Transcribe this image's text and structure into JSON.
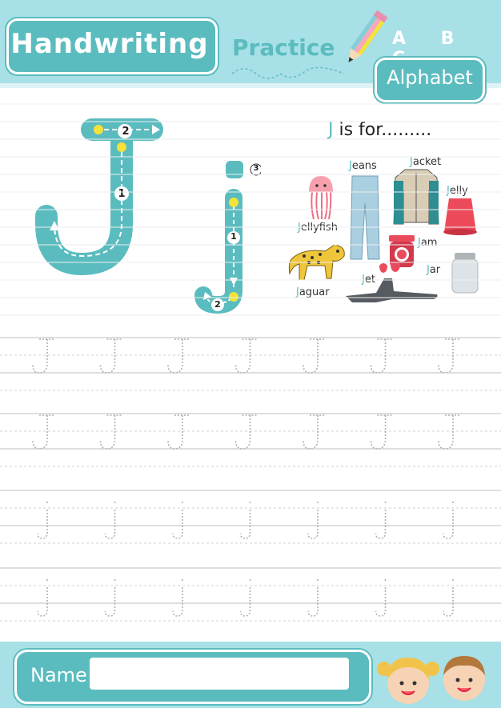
{
  "header": {
    "title": "Handwriting",
    "subtitle": "Practice",
    "abc": "A B C",
    "badge": "Alphabet"
  },
  "tracing": {
    "uppercase_steps": [
      "1",
      "2"
    ],
    "lowercase_steps": [
      "1",
      "2",
      "3"
    ]
  },
  "vocab": {
    "heading_letter": "J",
    "heading_rest": " is for.........",
    "words": [
      {
        "first": "J",
        "rest": "eans"
      },
      {
        "first": "J",
        "rest": "acket"
      },
      {
        "first": "J",
        "rest": "elly"
      },
      {
        "first": "J",
        "rest": "ellyfish"
      },
      {
        "first": "J",
        "rest": "am"
      },
      {
        "first": "J",
        "rest": "ar"
      },
      {
        "first": "J",
        "rest": "et"
      },
      {
        "first": "J",
        "rest": "aguar"
      }
    ]
  },
  "practice_rows": {
    "uppercase_letter": "J",
    "lowercase_letter": "j",
    "letters_per_row": 7
  },
  "footer": {
    "name_label": "Name",
    "name_value": ""
  },
  "colors": {
    "teal": "#5bbcbf",
    "light_teal": "#a7e0e6",
    "yellow": "#f3e23a",
    "guide_gray": "#b0b0b0"
  }
}
